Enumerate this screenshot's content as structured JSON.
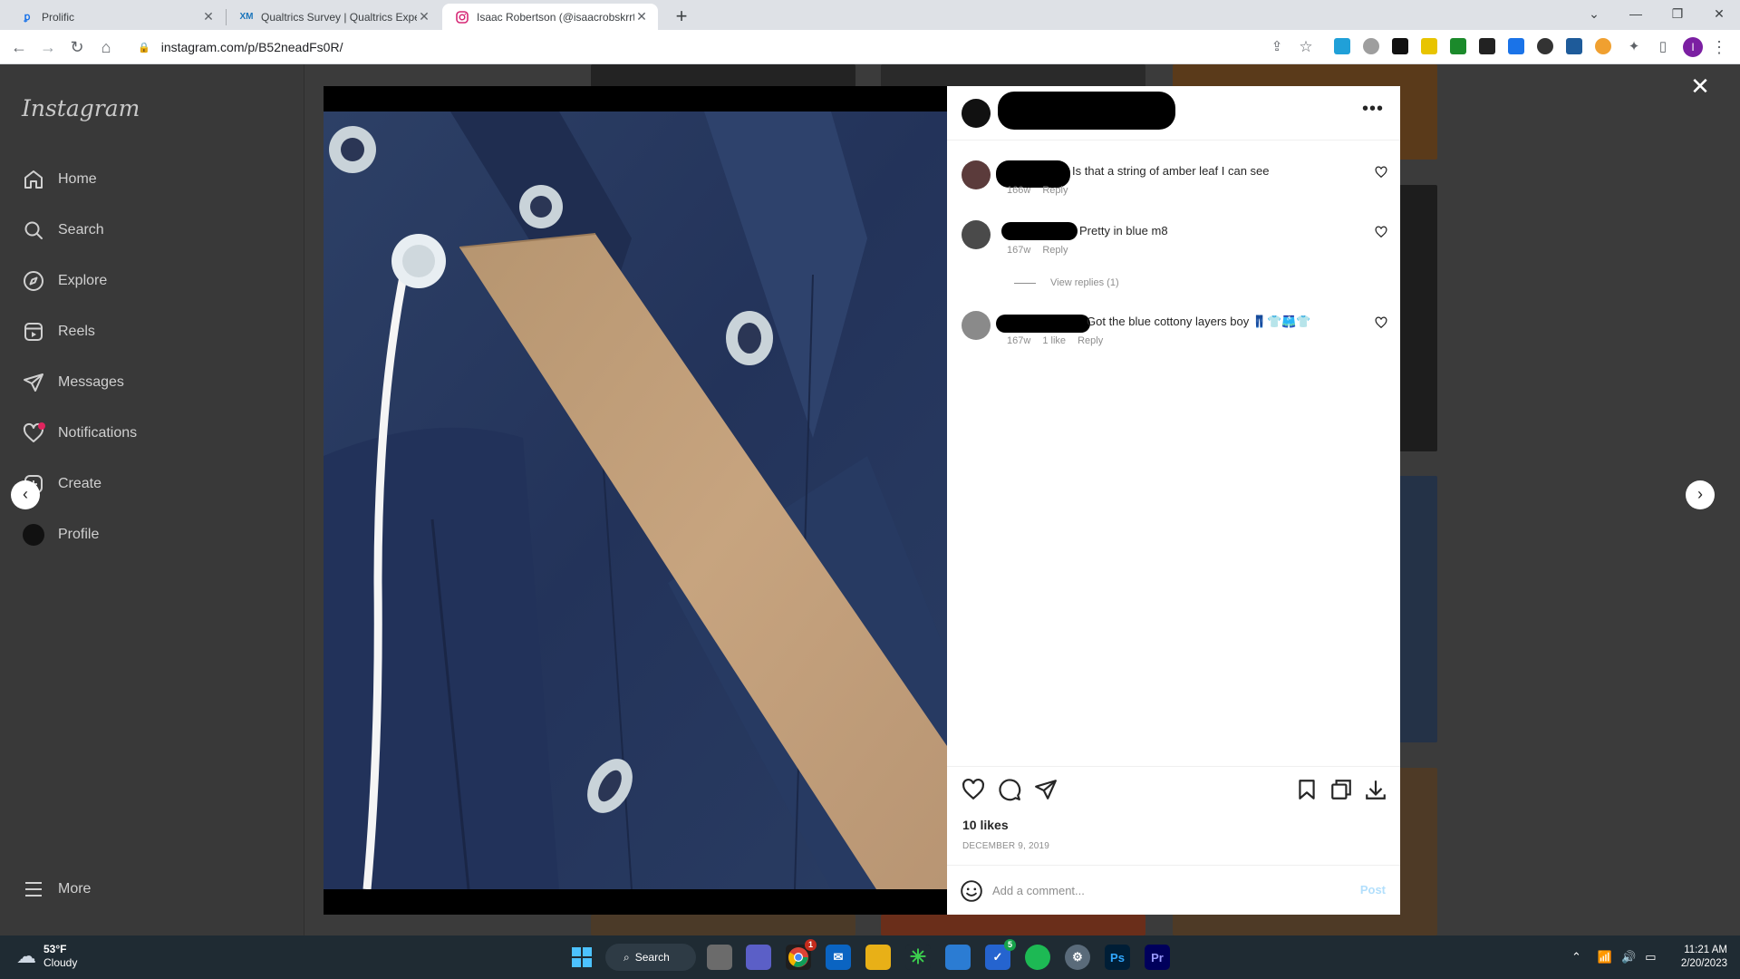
{
  "browser": {
    "tabs": [
      {
        "title": "Prolific",
        "icon": "prolific-icon",
        "active": false
      },
      {
        "title": "Qualtrics Survey | Qualtrics Exper",
        "icon": "qualtrics-icon",
        "active": false
      },
      {
        "title": "Isaac Robertson (@isaacrobskrrt",
        "icon": "instagram-icon",
        "active": true
      }
    ],
    "url": "instagram.com/p/B52neadFs0R/",
    "profile_initial": "I"
  },
  "sidebar": {
    "logo": "Instagram",
    "items": [
      {
        "label": "Home",
        "icon": "home-icon"
      },
      {
        "label": "Search",
        "icon": "search-icon"
      },
      {
        "label": "Explore",
        "icon": "explore-icon"
      },
      {
        "label": "Reels",
        "icon": "reels-icon"
      },
      {
        "label": "Messages",
        "icon": "messages-icon"
      },
      {
        "label": "Notifications",
        "icon": "heart-icon"
      },
      {
        "label": "Create",
        "icon": "create-icon"
      },
      {
        "label": "Profile",
        "icon": "profile-icon"
      }
    ],
    "more_label": "More"
  },
  "post": {
    "comments": [
      {
        "text": "Is that a string of amber leaf I can see",
        "age": "166w",
        "likes": "",
        "reply": "Reply"
      },
      {
        "text": "Pretty in blue m8",
        "age": "167w",
        "likes": "",
        "reply": "Reply"
      },
      {
        "text": "Got the blue cottony layers boy 👖👕🩳👕",
        "age": "167w",
        "likes": "1 like",
        "reply": "Reply"
      }
    ],
    "view_replies": "View replies (1)",
    "likes": "10 likes",
    "date": "DECEMBER 9, 2019",
    "comment_placeholder": "Add a comment...",
    "post_label": "Post"
  },
  "taskbar": {
    "weather_temp": "53°F",
    "weather_desc": "Cloudy",
    "search_label": "Search",
    "time": "11:21 AM",
    "date": "2/20/2023",
    "badge_chrome": "1",
    "badge_todo": "5"
  },
  "colors": {
    "accent_blue": "#0095f6",
    "post_disabled": "#b2dffc",
    "jacket": "#2b3c5c",
    "strap": "#c4a27e"
  }
}
